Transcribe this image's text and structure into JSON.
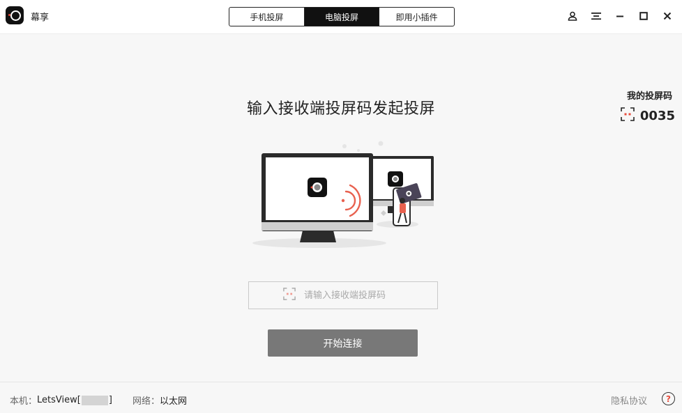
{
  "app": {
    "title": "幕享"
  },
  "tabs": [
    {
      "label": "手机投屏",
      "active": false
    },
    {
      "label": "电脑投屏",
      "active": true
    },
    {
      "label": "即用小插件",
      "active": false
    }
  ],
  "window_controls": [
    "user-icon",
    "menu-icon",
    "minimize-icon",
    "maximize-icon",
    "close-icon"
  ],
  "main": {
    "heading": "输入接收端投屏码发起投屏",
    "code_input_placeholder": "请输入接收端投屏码",
    "connect_button": "开始连接"
  },
  "my_code": {
    "label": "我的投屏码",
    "value": "0035"
  },
  "footer": {
    "local_label": "本机：",
    "local_value_prefix": "LetsView[",
    "local_value_suffix": "]",
    "network_label": "网络：",
    "network_value": "以太网",
    "privacy": "隐私协议",
    "help": "?"
  },
  "colors": {
    "accent": "#e74c3c",
    "button": "#787878",
    "dark": "#111111"
  }
}
